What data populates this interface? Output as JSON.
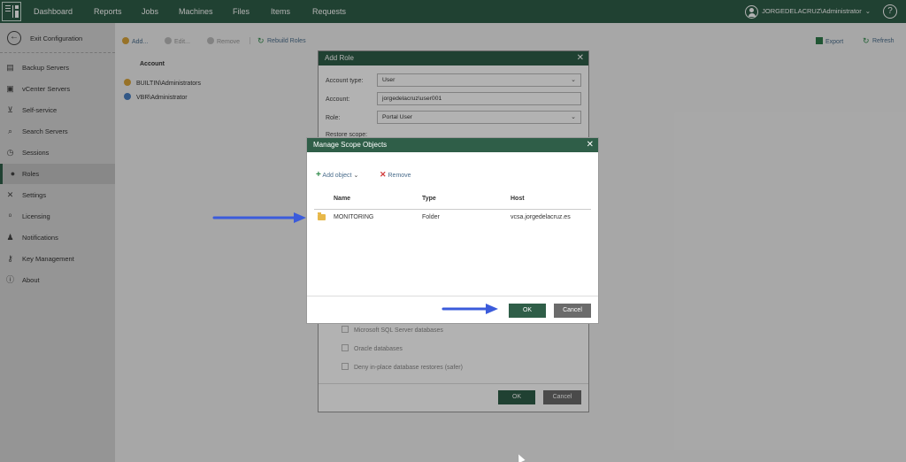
{
  "topnav": {
    "items": [
      "Dashboard",
      "Reports",
      "Jobs",
      "Machines",
      "Files",
      "Items",
      "Requests"
    ],
    "user": "JORGEDELACRUZ\\Administrator",
    "help": "?"
  },
  "sidebar": {
    "exit_label": "Exit Configuration",
    "items": [
      {
        "label": "Backup Servers",
        "icon": "server-icon"
      },
      {
        "label": "vCenter Servers",
        "icon": "vcenter-icon"
      },
      {
        "label": "Self-service",
        "icon": "cart-icon"
      },
      {
        "label": "Search Servers",
        "icon": "search-server-icon"
      },
      {
        "label": "Sessions",
        "icon": "clock-icon"
      },
      {
        "label": "Roles",
        "icon": "user-icon"
      },
      {
        "label": "Settings",
        "icon": "wrench-icon"
      },
      {
        "label": "Licensing",
        "icon": "license-icon"
      },
      {
        "label": "Notifications",
        "icon": "bell-icon"
      },
      {
        "label": "Key Management",
        "icon": "key-icon"
      },
      {
        "label": "About",
        "icon": "info-icon"
      }
    ],
    "active": "Roles"
  },
  "toolbar": {
    "add": "Add...",
    "edit": "Edit...",
    "remove": "Remove",
    "rebuild": "Rebuild Roles",
    "export": "Export",
    "refresh": "Refresh"
  },
  "roles_table": {
    "header": "Account",
    "rows": [
      "BUILTIN\\Administrators",
      "VBR\\Administrator"
    ]
  },
  "add_role": {
    "title": "Add Role",
    "account_type_label": "Account type:",
    "account_type_value": "User",
    "account_label": "Account:",
    "account_value": "jorgedelacruz\\user001",
    "role_label": "Role:",
    "role_value": "Portal User",
    "restore_scope_label": "Restore scope:",
    "checks": [
      "Microsoft SQL Server databases",
      "Oracle databases",
      "Deny in-place database restores (safer)"
    ],
    "ok": "OK",
    "cancel": "Cancel"
  },
  "scope_dialog": {
    "title": "Manage Scope Objects",
    "add_object": "Add object",
    "remove": "Remove",
    "columns": [
      "Name",
      "Type",
      "Host"
    ],
    "rows": [
      {
        "name": "MONITORING",
        "type": "Folder",
        "host": "vcsa.jorgedelacruz.es"
      }
    ],
    "ok": "OK",
    "cancel": "Cancel"
  },
  "colors": {
    "brand_green": "#2f5e48",
    "arrow_blue": "#3b5bdb",
    "folder_yellow": "#e7b84a"
  }
}
